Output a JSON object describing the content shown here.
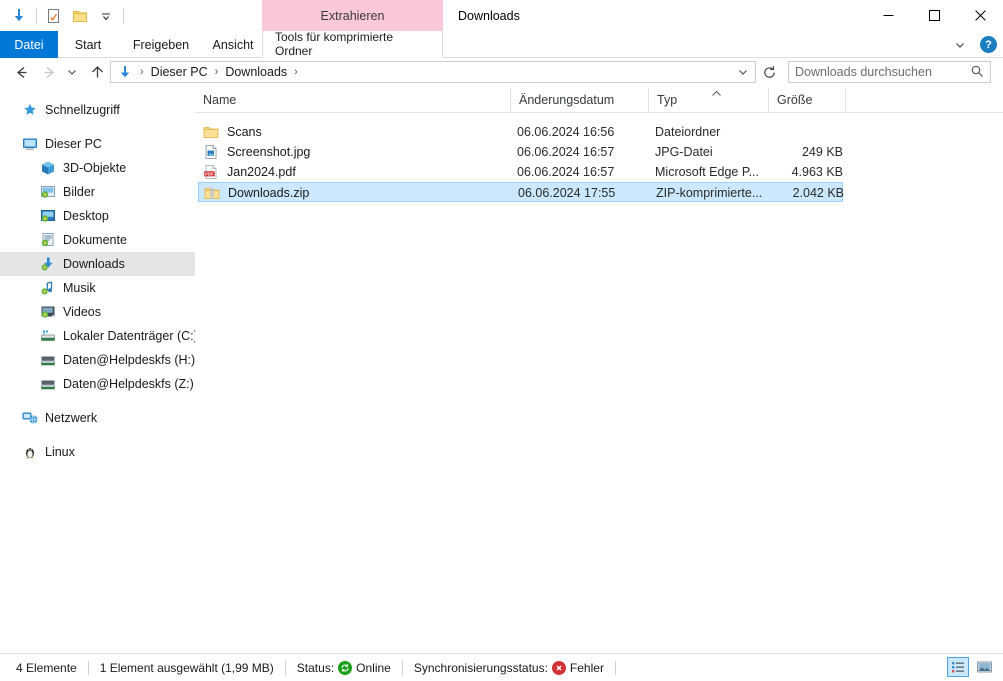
{
  "window": {
    "title": "Downloads",
    "minimize_label": "Minimieren",
    "maximize_label": "Maximieren",
    "close_label": "Schließen"
  },
  "quick_access_toolbar": {
    "items": [
      {
        "name": "downloads-icon",
        "label": "Downloads"
      },
      {
        "name": "properties-icon",
        "label": "Eigenschaften"
      },
      {
        "name": "new-folder-icon",
        "label": "Neuer Ordner"
      },
      {
        "name": "customize-chevron-icon",
        "label": "Schnellzugriffsleiste anpassen"
      }
    ]
  },
  "ribbon": {
    "contextual_tab_header": "Extrahieren",
    "tabs": [
      {
        "label": "Datei",
        "active": true
      },
      {
        "label": "Start",
        "active": false
      },
      {
        "label": "Freigeben",
        "active": false
      },
      {
        "label": "Ansicht",
        "active": false
      },
      {
        "label": "Tools für komprimierte Ordner",
        "active": false
      }
    ],
    "expand_label": "Menüband minimieren",
    "help_label": "?"
  },
  "navigation": {
    "back_label": "Zurück",
    "forward_label": "Vorwärts",
    "history_label": "Zuletzt besuchte Orte",
    "up_label": "Nach oben",
    "breadcrumb": [
      "Dieser PC",
      "Downloads"
    ],
    "breadcrumb_separator": "›",
    "dropdown_label": "Vorherige Orte",
    "refresh_label": "Aktualisieren"
  },
  "search": {
    "placeholder": "Downloads durchsuchen",
    "icon": "search-icon"
  },
  "sidebar": {
    "items": [
      {
        "label": "Schnellzugriff",
        "icon": "star-icon",
        "level": 0,
        "selected": false,
        "gap_before": false
      },
      {
        "label": "Dieser PC",
        "icon": "monitor-icon",
        "level": 0,
        "selected": false,
        "gap_before": true
      },
      {
        "label": "3D-Objekte",
        "icon": "cube-icon",
        "level": 1,
        "selected": false,
        "gap_before": false
      },
      {
        "label": "Bilder",
        "icon": "pictures-icon",
        "level": 1,
        "selected": false,
        "gap_before": false
      },
      {
        "label": "Desktop",
        "icon": "desktop-icon",
        "level": 1,
        "selected": false,
        "gap_before": false
      },
      {
        "label": "Dokumente",
        "icon": "documents-icon",
        "level": 1,
        "selected": false,
        "gap_before": false
      },
      {
        "label": "Downloads",
        "icon": "downloads-icon",
        "level": 1,
        "selected": true,
        "gap_before": false
      },
      {
        "label": "Musik",
        "icon": "music-icon",
        "level": 1,
        "selected": false,
        "gap_before": false
      },
      {
        "label": "Videos",
        "icon": "videos-icon",
        "level": 1,
        "selected": false,
        "gap_before": false
      },
      {
        "label": "Lokaler Datenträger (C:)",
        "icon": "drive-icon",
        "level": 1,
        "selected": false,
        "gap_before": false
      },
      {
        "label": "Daten@Helpdeskfs (H:)",
        "icon": "network-drive-icon",
        "level": 1,
        "selected": false,
        "gap_before": false
      },
      {
        "label": "Daten@Helpdeskfs (Z:)",
        "icon": "network-drive-icon",
        "level": 1,
        "selected": false,
        "gap_before": false
      },
      {
        "label": "Netzwerk",
        "icon": "network-icon",
        "level": 0,
        "selected": false,
        "gap_before": true
      },
      {
        "label": "Linux",
        "icon": "penguin-icon",
        "level": 0,
        "selected": false,
        "gap_before": true
      }
    ]
  },
  "file_list": {
    "columns": [
      {
        "label": "Name",
        "sorted": false
      },
      {
        "label": "Änderungsdatum",
        "sorted": false
      },
      {
        "label": "Typ",
        "sorted": true,
        "sort_direction": "asc"
      },
      {
        "label": "Größe",
        "sorted": false
      }
    ],
    "rows": [
      {
        "name": "Scans",
        "date": "06.06.2024 16:56",
        "type": "Dateiordner",
        "size": "",
        "icon": "folder-icon",
        "selected": false
      },
      {
        "name": "Screenshot.jpg",
        "date": "06.06.2024 16:57",
        "type": "JPG-Datei",
        "size": "249 KB",
        "icon": "image-icon",
        "selected": false
      },
      {
        "name": "Jan2024.pdf",
        "date": "06.06.2024 16:57",
        "type": "Microsoft Edge P...",
        "size": "4.963 KB",
        "icon": "pdf-icon",
        "selected": false
      },
      {
        "name": "Downloads.zip",
        "date": "06.06.2024 17:55",
        "type": "ZIP-komprimierte...",
        "size": "2.042 KB",
        "icon": "zip-icon",
        "selected": true
      }
    ]
  },
  "status_bar": {
    "item_count": "4 Elemente",
    "selection": "1 Element ausgewählt (1,99 MB)",
    "status_label": "Status:",
    "status_value": "Online",
    "sync_label": "Synchronisierungsstatus:",
    "sync_value": "Fehler",
    "view_details_label": "Details",
    "view_large_icons_label": "Große Symbole"
  },
  "colors": {
    "accent": "#0078d7",
    "contextual_tab": "#f9c9da",
    "selection": "#cce8ff",
    "sidebar_selection": "#e5e5e5",
    "status_ok": "#1aa01a",
    "status_error": "#d13438"
  }
}
